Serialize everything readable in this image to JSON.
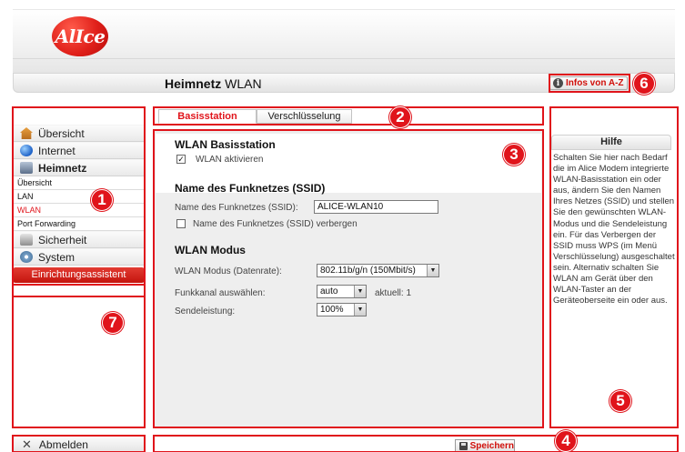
{
  "brand": {
    "logo_text": "AlIce",
    "accent": "#e0141b"
  },
  "header": {
    "title_bold": "Heimnetz",
    "title_light": "WLAN",
    "infos_button": "Infos von A-Z"
  },
  "tabs": [
    {
      "label": "Basisstation",
      "active": true
    },
    {
      "label": "Verschlüsselung",
      "active": false
    }
  ],
  "sidebar": {
    "items": [
      {
        "label": "Übersicht",
        "icon": "house-icon"
      },
      {
        "label": "Internet",
        "icon": "globe-icon"
      },
      {
        "label": "Heimnetz",
        "icon": "network-icon"
      },
      {
        "label": "Sicherheit",
        "icon": "lock-icon"
      },
      {
        "label": "System",
        "icon": "gear-icon"
      }
    ],
    "subitems": [
      "Übersicht",
      "LAN",
      "WLAN",
      "Port Forwarding"
    ],
    "assistant": "Einrichtungsassistent",
    "logout": "Abmelden"
  },
  "main": {
    "section1_title": "WLAN Basisstation",
    "wlan_enable_label": "WLAN aktivieren",
    "wlan_enabled": true,
    "section2_title": "Name des Funknetzes (SSID)",
    "ssid_label": "Name des Funknetzes (SSID):",
    "ssid_value": "ALICE-WLAN10",
    "hide_ssid_label": "Name des Funknetzes (SSID) verbergen",
    "hide_ssid": false,
    "section3_title": "WLAN Modus",
    "mode_label": "WLAN Modus (Datenrate):",
    "mode_value": "802.11b/g/n (150Mbit/s)",
    "channel_label": "Funkkanal auswählen:",
    "channel_value": "auto",
    "channel_current": "aktuell: 1",
    "power_label": "Sendeleistung:",
    "power_value": "100%"
  },
  "help": {
    "title": "Hilfe",
    "text": "Schalten Sie hier nach Bedarf die im Alice Modem integrierte WLAN-Basisstation ein oder aus, ändern Sie den Namen Ihres Netzes (SSID) und stellen Sie den gewünschten WLAN-Modus und die Sendeleistung ein. Für das Verbergen der SSID muss WPS (im Menü Verschlüsselung) ausgeschaltet sein. Alternativ schalten Sie WLAN am Gerät über den WLAN-Taster an der Geräteoberseite ein oder aus."
  },
  "footer": {
    "save_label": "Speichern"
  },
  "annotations": [
    "1",
    "2",
    "3",
    "4",
    "5",
    "6",
    "7"
  ]
}
